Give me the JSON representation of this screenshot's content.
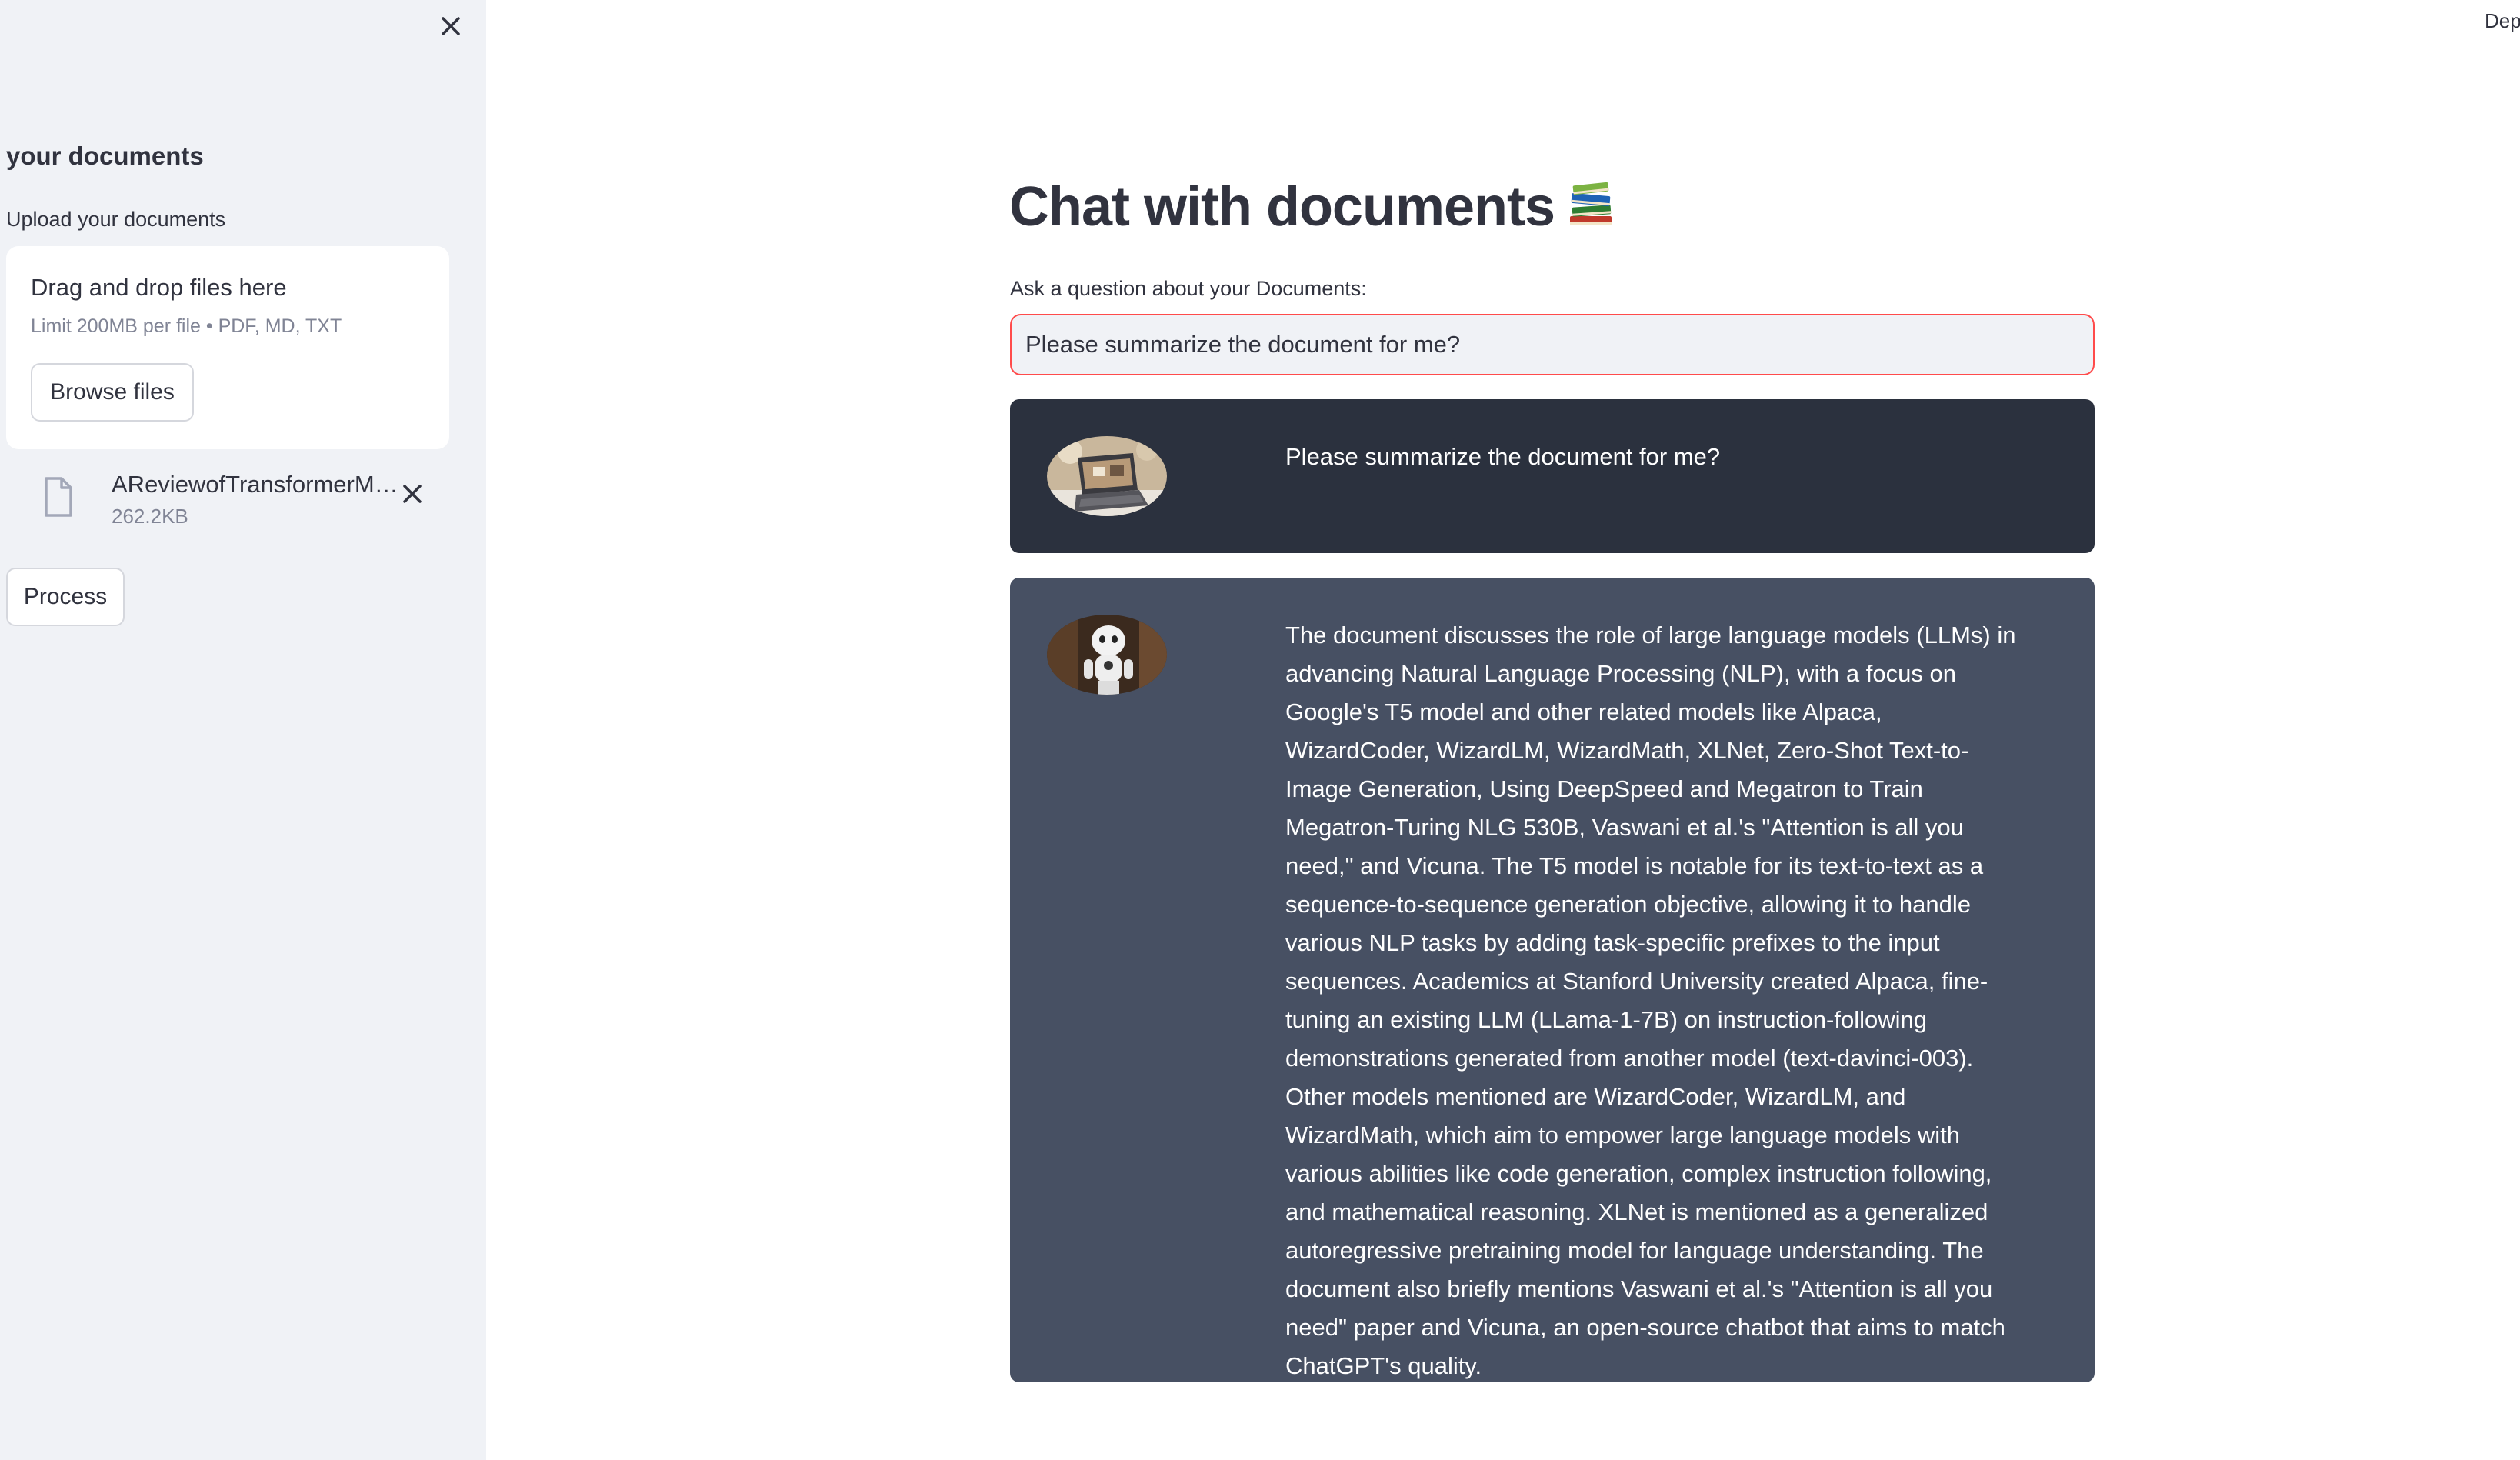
{
  "sidebar": {
    "title": "your documents",
    "upload_label": "Upload your documents",
    "dropzone": {
      "title": "Drag and drop files here",
      "limit_text": "Limit 200MB per file • PDF, MD, TXT",
      "browse_label": "Browse files"
    },
    "files": [
      {
        "name": "AReviewofTransformerM…",
        "size": "262.2KB"
      }
    ],
    "process_label": "Process"
  },
  "header": {
    "deploy_label": "Dep"
  },
  "main": {
    "title": "Chat with documents",
    "title_icon": "books-emoji",
    "question_label": "Ask a question about your Documents:",
    "question_value": "Please summarize the document for me?",
    "messages": [
      {
        "role": "user",
        "avatar": "user-photo-laptop",
        "text": "Please summarize the document for me?"
      },
      {
        "role": "bot",
        "avatar": "robot-photo",
        "text": "The document discusses the role of large language models (LLMs) in advancing Natural Language Processing (NLP), with a focus on Google's T5 model and other related models like Alpaca, WizardCoder, WizardLM, WizardMath, XLNet, Zero-Shot Text-to-Image Generation, Using DeepSpeed and Megatron to Train Megatron-Turing NLG 530B, Vaswani et al.'s \"Attention is all you need,\" and Vicuna. The T5 model is notable for its text-to-text as a sequence-to-sequence generation objective, allowing it to handle various NLP tasks by adding task-specific prefixes to the input sequences. Academics at Stanford University created Alpaca, fine-tuning an existing LLM (LLama-1-7B) on instruction-following demonstrations generated from another model (text-davinci-003). Other models mentioned are WizardCoder, WizardLM, and WizardMath, which aim to empower large language models with various abilities like code generation, complex instruction following, and mathematical reasoning. XLNet is mentioned as a generalized autoregressive pretraining model for language understanding. The document also briefly mentions Vaswani et al.'s \"Attention is all you need\" paper and Vicuna, an open-source chatbot that aims to match ChatGPT's quality."
      }
    ]
  },
  "colors": {
    "sidebar_bg": "#f0f2f6",
    "user_msg_bg": "#2b313e",
    "bot_msg_bg": "#475063",
    "focus_border": "#ff4b4b",
    "text": "#31333f",
    "muted": "#808495"
  }
}
